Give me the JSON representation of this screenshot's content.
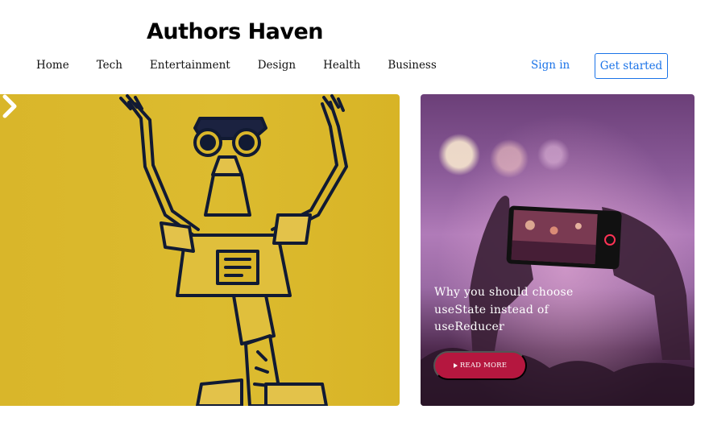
{
  "header": {
    "brand": "Authors Haven",
    "nav": [
      "Home",
      "Tech",
      "Entertainment",
      "Design",
      "Health",
      "Business"
    ],
    "sign_in": "Sign in",
    "get_started": "Get started"
  },
  "hero": {
    "image": "robot-illustration",
    "next_icon": "chevron-right-icon"
  },
  "featured_card": {
    "image": "concert-phone-photo",
    "title": "Why you should choose useState instead of useReducer",
    "read_more": "READ MORE",
    "button_color": "#b5173f"
  },
  "colors": {
    "accent": "#1a73e8",
    "hero_bg": "#dcbb2f"
  }
}
